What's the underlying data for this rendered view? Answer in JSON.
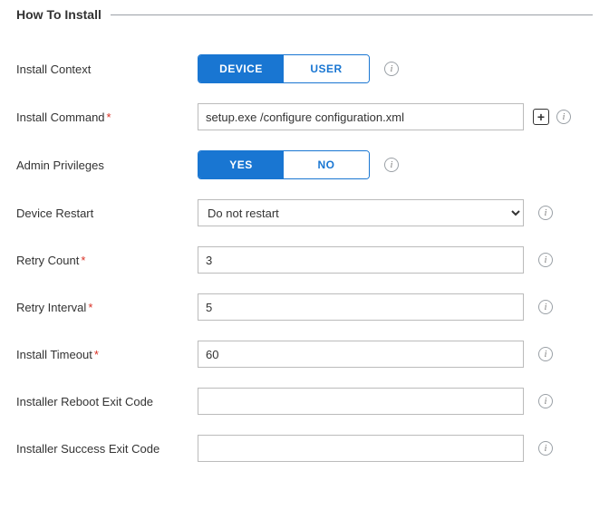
{
  "section": {
    "title": "How To Install"
  },
  "labels": {
    "install_context": "Install Context",
    "install_command": "Install Command",
    "admin_privileges": "Admin Privileges",
    "device_restart": "Device Restart",
    "retry_count": "Retry Count",
    "retry_interval": "Retry Interval",
    "install_timeout": "Install Timeout",
    "reboot_exit_code": "Installer Reboot Exit Code",
    "success_exit_code": "Installer Success Exit Code"
  },
  "install_context": {
    "device": "DEVICE",
    "user": "USER",
    "selected": "device"
  },
  "install_command": {
    "value": "setup.exe /configure configuration.xml"
  },
  "admin_privileges": {
    "yes": "YES",
    "no": "NO",
    "selected": "yes"
  },
  "device_restart": {
    "value": "Do not restart"
  },
  "retry_count": {
    "value": "3"
  },
  "retry_interval": {
    "value": "5"
  },
  "install_timeout": {
    "value": "60"
  },
  "reboot_exit_code": {
    "value": ""
  },
  "success_exit_code": {
    "value": ""
  },
  "req_marker": "*",
  "info_glyph": "i",
  "plus_glyph": "+"
}
